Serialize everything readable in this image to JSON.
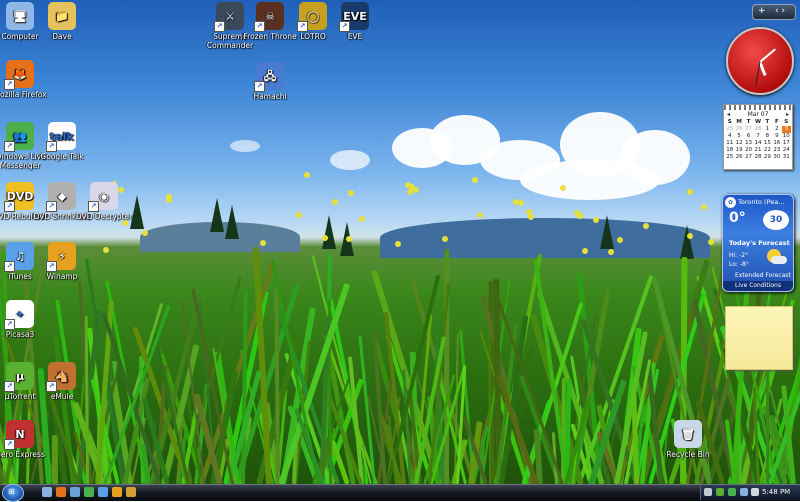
{
  "desktop_icons": [
    {
      "label": "Computer",
      "color": "#8fb8e8",
      "symbol": "🖥",
      "name": "computer-icon"
    },
    {
      "label": "Dave",
      "color": "#e6c35a",
      "symbol": "📁",
      "name": "user-folder-icon"
    },
    {
      "label": "Mozilla Firefox",
      "color": "#e8701a",
      "symbol": "🦊",
      "name": "firefox-icon"
    },
    {
      "label": "Windows Live Messenger",
      "color": "#4ab04a",
      "symbol": "👥",
      "name": "messenger-icon"
    },
    {
      "label": "Google Talk",
      "color": "#ffffff",
      "symbol": "talk",
      "name": "google-talk-icon"
    },
    {
      "label": "DVD Rebuilder",
      "color": "#f0c020",
      "symbol": "DVD",
      "name": "dvd-rebuilder-icon"
    },
    {
      "label": "DVD Shrink 3.2",
      "color": "#b0b0b0",
      "symbol": "◆",
      "name": "dvd-shrink-icon"
    },
    {
      "label": "DVD Decrypter",
      "color": "#d8d8e8",
      "symbol": "◉",
      "name": "dvd-decrypter-icon"
    },
    {
      "label": "iTunes",
      "color": "#5aa0e8",
      "symbol": "♫",
      "name": "itunes-icon"
    },
    {
      "label": "Winamp",
      "color": "#e8a020",
      "symbol": "⚡",
      "name": "winamp-icon"
    },
    {
      "label": "Picasa3",
      "color": "#ffffff",
      "symbol": "✦",
      "name": "picasa-icon"
    },
    {
      "label": "µTorrent",
      "color": "#5ab030",
      "symbol": "µ",
      "name": "utorrent-icon"
    },
    {
      "label": "eMule",
      "color": "#c07030",
      "symbol": "🐴",
      "name": "emule-icon"
    },
    {
      "label": "Nero Express",
      "color": "#c03030",
      "symbol": "N",
      "name": "nero-icon"
    },
    {
      "label": "Supreme Commander",
      "color": "#3a4a5a",
      "symbol": "⚔",
      "name": "supreme-commander-icon"
    },
    {
      "label": "Frozen Throne",
      "color": "#5a3020",
      "symbol": "☠",
      "name": "frozen-throne-icon"
    },
    {
      "label": "LOTRO",
      "color": "#c8a020",
      "symbol": "◯",
      "name": "lotro-icon"
    },
    {
      "label": "EVE",
      "color": "#1a3a6a",
      "symbol": "EVE",
      "name": "eve-icon"
    },
    {
      "label": "Hamachi",
      "color": "#4a7ad0",
      "symbol": "🖧",
      "name": "hamachi-icon"
    },
    {
      "label": "Recycle Bin",
      "color": "#c8d8e8",
      "symbol": "🗑",
      "name": "recycle-bin-icon"
    }
  ],
  "calendar": {
    "month": "Mar 07",
    "weekdays": [
      "S",
      "M",
      "T",
      "W",
      "T",
      "F",
      "S"
    ],
    "days": [
      "25",
      "26",
      "27",
      "28",
      "1",
      "2",
      "3",
      "4",
      "5",
      "6",
      "7",
      "8",
      "9",
      "10",
      "11",
      "12",
      "13",
      "14",
      "15",
      "16",
      "17",
      "18",
      "19",
      "20",
      "21",
      "22",
      "23",
      "24",
      "25",
      "26",
      "27",
      "28",
      "29",
      "30",
      "31"
    ],
    "today": "3"
  },
  "weather": {
    "city": "Toronto (Pea...",
    "temp": "0°",
    "dial": "30",
    "forecast_title": "Today's Forecast",
    "hi": "Hi: -2°",
    "lo": "Lo: -8°",
    "extended": "Extended Forecast",
    "live": "Live Conditions"
  },
  "sidebar": {
    "add": "+",
    "arrows": "‹ ›"
  },
  "taskbar": {
    "time": "5:48 PM",
    "start_symbol": "⊞"
  },
  "colors": {
    "clock_face": "#d01818",
    "sky": "#3e86d6",
    "grass": "#3f8f1e"
  }
}
